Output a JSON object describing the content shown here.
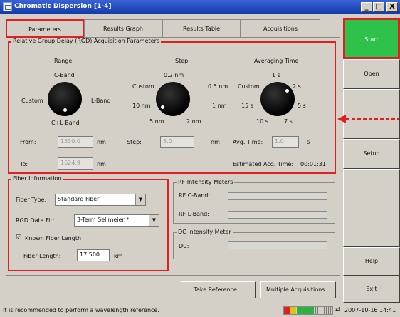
{
  "window": {
    "title": "Chromatic Dispersion [1-4]",
    "min": "_",
    "max": "□",
    "close": "X"
  },
  "tabs": [
    {
      "label": "Parameters"
    },
    {
      "label": "Results Graph"
    },
    {
      "label": "Results Table"
    },
    {
      "label": "Acquisitions"
    }
  ],
  "rgd": {
    "legend": "Relative Group Delay (RGD) Acquisition Parameters",
    "range": {
      "title": "Range",
      "options": [
        "C-Band",
        "L-Band",
        "C+L-Band",
        "Custom"
      ]
    },
    "step": {
      "title": "Step",
      "options": [
        "0.2 nm",
        "0.5 nm",
        "1 nm",
        "2 nm",
        "5 nm",
        "10 nm",
        "Custom"
      ]
    },
    "avg": {
      "title": "Averaging Time",
      "options": [
        "1 s",
        "2 s",
        "5 s",
        "7 s",
        "10 s",
        "15 s",
        "Custom"
      ]
    },
    "from_label": "From:",
    "from_value": "1530.0",
    "from_unit": "nm",
    "to_label": "To:",
    "to_value": "1624.9",
    "to_unit": "nm",
    "step_label": "Step:",
    "step_value": "5.0",
    "step_unit": "nm",
    "avgtime_label": "Avg. Time:",
    "avgtime_value": "1.0",
    "avgtime_unit": "s",
    "est_label": "Estimated Acq. Time:",
    "est_value": "00:01:31"
  },
  "fiber": {
    "legend": "Fiber Information",
    "type_label": "Fiber Type:",
    "type_value": "Standard Fiber",
    "fit_label": "RGD Data Fit:",
    "fit_value": "3-Term Sellmeier *",
    "known_check": "☑",
    "known_label": "Known Fiber Length",
    "length_label": "Fiber Length:",
    "length_value": "17.500",
    "length_unit": "km"
  },
  "rf": {
    "legend": "RF Intensity Meters",
    "c_label": "RF C-Band:",
    "l_label": "RF L-Band:"
  },
  "dc": {
    "legend": "DC Intensity Meter",
    "label": "DC:"
  },
  "buttons": {
    "take_reference": "Take Reference...",
    "multiple_acq": "Multiple Acquisitions..."
  },
  "right_buttons": {
    "start": "Start",
    "open": "Open",
    "setup": "Setup",
    "help": "Help",
    "exit": "Exit"
  },
  "status": {
    "message": "It is recommended to perform a wavelength reference.",
    "datetime": "2007-10-16 14:41"
  },
  "colors": {
    "start_green": "#2ec24a",
    "highlight_red": "#e02020",
    "titlebar_blue": "#1e4cc0"
  }
}
